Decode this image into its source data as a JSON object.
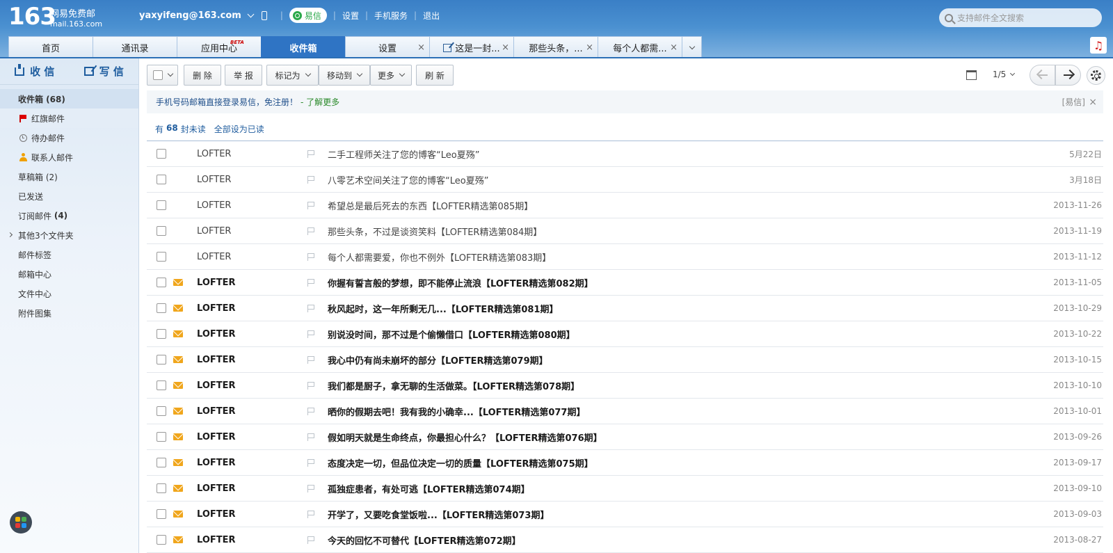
{
  "header": {
    "logo_num": "163",
    "logo_cn": "网易免费邮",
    "logo_en": "mail.163.com",
    "user": "yaxyifeng@163.com",
    "yixin_label": "易信",
    "links": [
      "设置",
      "手机服务",
      "退出"
    ],
    "search_placeholder": "支持邮件全文搜索"
  },
  "tabs": [
    {
      "label": "首页"
    },
    {
      "label": "通讯录"
    },
    {
      "label": "应用中心",
      "badge": "BETA"
    },
    {
      "label": "收件箱",
      "active": true
    },
    {
      "label": "设置"
    },
    {
      "label": "这是一封..."
    },
    {
      "label": "那些头条，..."
    },
    {
      "label": "每个人都需..."
    }
  ],
  "sidebar": {
    "receive_label": "收 信",
    "write_label": "写 信",
    "items": [
      {
        "label": "收件箱 (68)"
      },
      {
        "label": "红旗邮件"
      },
      {
        "label": "待办邮件"
      },
      {
        "label": "联系人邮件"
      },
      {
        "label": "草稿箱 (2)"
      },
      {
        "label": "已发送"
      },
      {
        "label": "订阅邮件",
        "count": "(4)"
      },
      {
        "label": "其他3个文件夹"
      },
      {
        "label": "邮件标签"
      },
      {
        "label": "邮箱中心"
      },
      {
        "label": "文件中心"
      },
      {
        "label": "附件图集"
      }
    ],
    "app_colors": [
      "#f4b400",
      "#4caf50",
      "#e53935",
      "#2196f3"
    ]
  },
  "toolbar": {
    "delete": "删 除",
    "report": "举 报",
    "mark_as": "标记为",
    "move_to": "移动到",
    "more": "更多",
    "refresh": "刷 新",
    "page": "1/5"
  },
  "notice": {
    "text": "手机号码邮箱直接登录易信，免注册！",
    "more": "- 了解更多",
    "tag": "[易信]",
    "close": "×"
  },
  "unread": {
    "prefix": "有",
    "count": "68",
    "suffix": "封未读",
    "mark_all": "全部设为已读"
  },
  "mails": [
    {
      "sender": "LOFTER",
      "subject": "二手工程师关注了您的博客“Leo夏殇”",
      "date": "5月22日",
      "unread": false
    },
    {
      "sender": "LOFTER",
      "subject": "八零艺术空间关注了您的博客“Leo夏殇”",
      "date": "3月18日",
      "unread": false
    },
    {
      "sender": "LOFTER",
      "subject": "希望总是最后死去的东西【LOFTER精选第085期】",
      "date": "2013-11-26",
      "unread": false
    },
    {
      "sender": "LOFTER",
      "subject": "那些头条，不过是谈资笑料【LOFTER精选第084期】",
      "date": "2013-11-19",
      "unread": false
    },
    {
      "sender": "LOFTER",
      "subject": "每个人都需要爱，你也不例外【LOFTER精选第083期】",
      "date": "2013-11-12",
      "unread": false
    },
    {
      "sender": "LOFTER",
      "subject": "你握有誓言般的梦想，即不能停止流浪【LOFTER精选第082期】",
      "date": "2013-11-05",
      "unread": true
    },
    {
      "sender": "LOFTER",
      "subject": "秋风起时，这一年所剩无几...【LOFTER精选第081期】",
      "date": "2013-10-29",
      "unread": true
    },
    {
      "sender": "LOFTER",
      "subject": "别说没时间，那不过是个偷懒借口【LOFTER精选第080期】",
      "date": "2013-10-22",
      "unread": true
    },
    {
      "sender": "LOFTER",
      "subject": "我心中仍有尚未崩坏的部分【LOFTER精选第079期】",
      "date": "2013-10-15",
      "unread": true
    },
    {
      "sender": "LOFTER",
      "subject": "我们都是厨子，拿无聊的生活做菜。【LOFTER精选第078期】",
      "date": "2013-10-10",
      "unread": true
    },
    {
      "sender": "LOFTER",
      "subject": "晒你的假期去吧！我有我的小确幸...【LOFTER精选第077期】",
      "date": "2013-10-01",
      "unread": true
    },
    {
      "sender": "LOFTER",
      "subject": "假如明天就是生命终点，你最担心什么？【LOFTER精选第076期】",
      "date": "2013-09-26",
      "unread": true
    },
    {
      "sender": "LOFTER",
      "subject": "态度决定一切，但品位决定一切的质量【LOFTER精选第075期】",
      "date": "2013-09-17",
      "unread": true
    },
    {
      "sender": "LOFTER",
      "subject": "孤独症患者，有处可逃【LOFTER精选第074期】",
      "date": "2013-09-10",
      "unread": true
    },
    {
      "sender": "LOFTER",
      "subject": "开学了，又要吃食堂饭啦...【LOFTER精选第073期】",
      "date": "2013-09-03",
      "unread": true
    },
    {
      "sender": "LOFTER",
      "subject": "今天的回忆不可替代【LOFTER精选第072期】",
      "date": "2013-08-27",
      "unread": true
    }
  ]
}
